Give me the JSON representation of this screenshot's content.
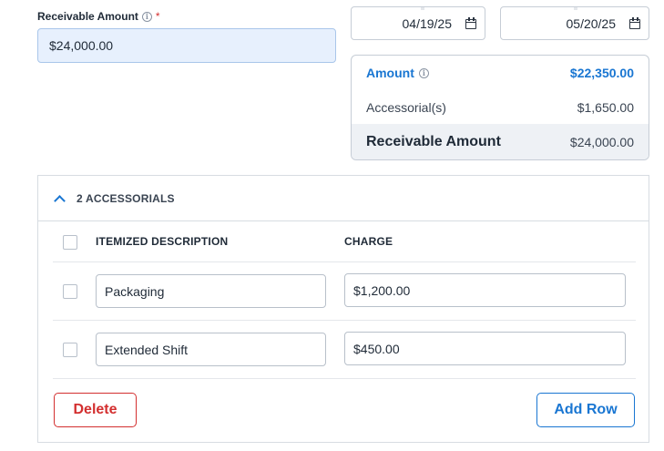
{
  "receivable_field": {
    "label": "Receivable Amount",
    "info_icon": "info-icon",
    "required_mark": "*",
    "value": "$24,000.00"
  },
  "dates": {
    "start": "04/19/25",
    "end": "05/20/25",
    "icon": "calendar-icon"
  },
  "summary": {
    "amount_label": "Amount",
    "amount_value": "$22,350.00",
    "accessorials_label": "Accessorial(s)",
    "accessorials_value": "$1,650.00",
    "receivable_label": "Receivable Amount",
    "receivable_value": "$24,000.00"
  },
  "accessorials": {
    "title": "2 ACCESSORIALS",
    "expanded": true,
    "columns": [
      "ITEMIZED DESCRIPTION",
      "CHARGE"
    ],
    "rows": [
      {
        "description": "Packaging",
        "charge": "$1,200.00",
        "checked": false
      },
      {
        "description": "Extended Shift",
        "charge": "$450.00",
        "checked": false
      }
    ],
    "delete_label": "Delete",
    "add_row_label": "Add Row"
  },
  "colors": {
    "accent": "#1976d2",
    "danger": "#d32f2f",
    "input_highlight": "#e7f0fd"
  }
}
